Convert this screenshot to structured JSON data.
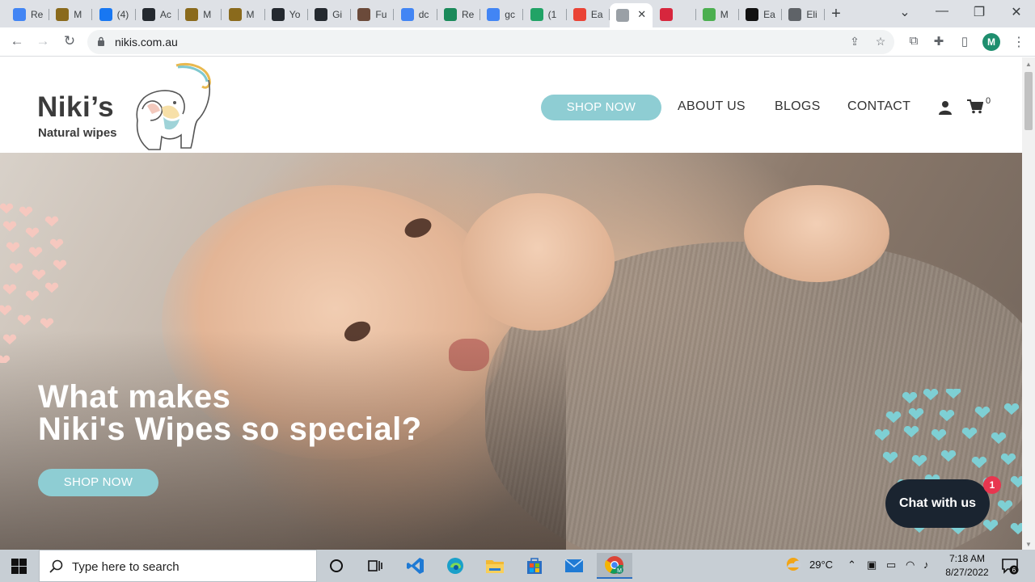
{
  "browser": {
    "tabs": [
      {
        "label": "Re",
        "icon": "google-icon",
        "color": "#4285f4"
      },
      {
        "label": "M",
        "icon": "mail-icon",
        "color": "#8a6a1c"
      },
      {
        "label": "(4)",
        "icon": "facebook-icon",
        "color": "#1877f2"
      },
      {
        "label": "Ac",
        "icon": "github-icon",
        "color": "#24292f"
      },
      {
        "label": "M",
        "icon": "mail-icon",
        "color": "#8a6a1c"
      },
      {
        "label": "M",
        "icon": "mail-icon",
        "color": "#8a6a1c"
      },
      {
        "label": "Yo",
        "icon": "github-icon",
        "color": "#24292f"
      },
      {
        "label": "Gi",
        "icon": "github-icon",
        "color": "#24292f"
      },
      {
        "label": "Fu",
        "icon": "avatar-icon",
        "color": "#6b4a3a"
      },
      {
        "label": "dc",
        "icon": "google-icon",
        "color": "#4285f4"
      },
      {
        "label": "Re",
        "icon": "v-icon",
        "color": "#1a8a5a"
      },
      {
        "label": "gc",
        "icon": "google-icon",
        "color": "#4285f4"
      },
      {
        "label": "(1",
        "icon": "badge-icon",
        "color": "#21a366"
      },
      {
        "label": "Ea",
        "icon": "play-icon",
        "color": "#ea4335"
      },
      {
        "label": "",
        "icon": "page-icon",
        "color": "#9aa0a6",
        "active": true
      },
      {
        "label": "",
        "icon": "tbc-icon",
        "color": "#d7263d"
      },
      {
        "label": "M",
        "icon": "leaf-icon",
        "color": "#4caf50"
      },
      {
        "label": "Ea",
        "icon": "zt-icon",
        "color": "#111111"
      },
      {
        "label": "Eli",
        "icon": "doc-icon",
        "color": "#5f6368"
      }
    ],
    "close_tab_label": "✕",
    "new_tab_label": "+",
    "window_controls": {
      "dropdown": "⌄",
      "minimize": "—",
      "maximize": "❐",
      "close": "✕"
    },
    "url": "nikis.com.au",
    "profile_initial": "M"
  },
  "site": {
    "logo_text": "Niki’s",
    "logo_subtext": "Natural wipes",
    "nav": {
      "shop_now": "SHOP NOW",
      "about": "ABOUT US",
      "blogs": "BLOGS",
      "contact": "CONTACT"
    },
    "cart_count": "0",
    "hero": {
      "title_line1": "What makes",
      "title_line2": "Niki's Wipes so special?",
      "button": "SHOP NOW"
    },
    "chat": {
      "label": "Chat with us",
      "badge": "1"
    },
    "colors": {
      "accent": "#8ecdd3",
      "chat_bg": "#1a2430",
      "badge": "#e8364f",
      "dots_left": "#f6c8bf",
      "dots_right": "#7ecfd4"
    }
  },
  "taskbar": {
    "search_placeholder": "Type here to search",
    "weather": "29°C",
    "time": "7:18 AM",
    "date": "8/27/2022",
    "notification_count": "6"
  }
}
